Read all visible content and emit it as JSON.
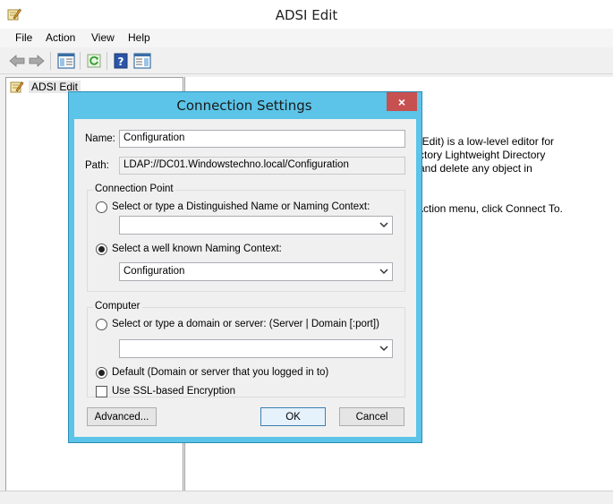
{
  "window": {
    "title": "ADSI Edit"
  },
  "menu": [
    "File",
    "Action",
    "View",
    "Help"
  ],
  "toolbar": {
    "buttons": [
      "back-arrow-icon",
      "forward-arrow-icon",
      "show-hide-console-tree-icon",
      "refresh-icon",
      "help-icon",
      "show-action-pane-icon"
    ]
  },
  "tree": {
    "root_label": "ADSI Edit"
  },
  "description": {
    "line1": "I Edit) is a low-level editor for",
    "line2": "ctory Lightweight Directory",
    "line3": "and delete any object in",
    "line4": "Action menu, click Connect To."
  },
  "dialog": {
    "title": "Connection Settings",
    "close_label": "×",
    "name_label": "Name:",
    "name_value": "Configuration",
    "path_label": "Path:",
    "path_value": "LDAP://DC01.Windowstechno.local/Configuration",
    "connection_point": {
      "legend": "Connection Point",
      "option_dn_label": "Select or type a Distinguished Name or Naming Context:",
      "option_dn_selected": false,
      "dn_value": "",
      "option_wellknown_label": "Select a well known Naming Context:",
      "option_wellknown_selected": true,
      "wellknown_value": "Configuration"
    },
    "computer": {
      "legend": "Computer",
      "option_server_label": "Select or type a domain or server: (Server | Domain [:port])",
      "option_server_selected": false,
      "server_value": "",
      "option_default_label": "Default (Domain or server that you logged in to)",
      "option_default_selected": true,
      "ssl_label": "Use SSL-based Encryption",
      "ssl_checked": false
    },
    "buttons": {
      "advanced": "Advanced...",
      "ok": "OK",
      "cancel": "Cancel"
    }
  },
  "colors": {
    "dialog_frame": "#5bc4e8",
    "close_button": "#c75050"
  }
}
